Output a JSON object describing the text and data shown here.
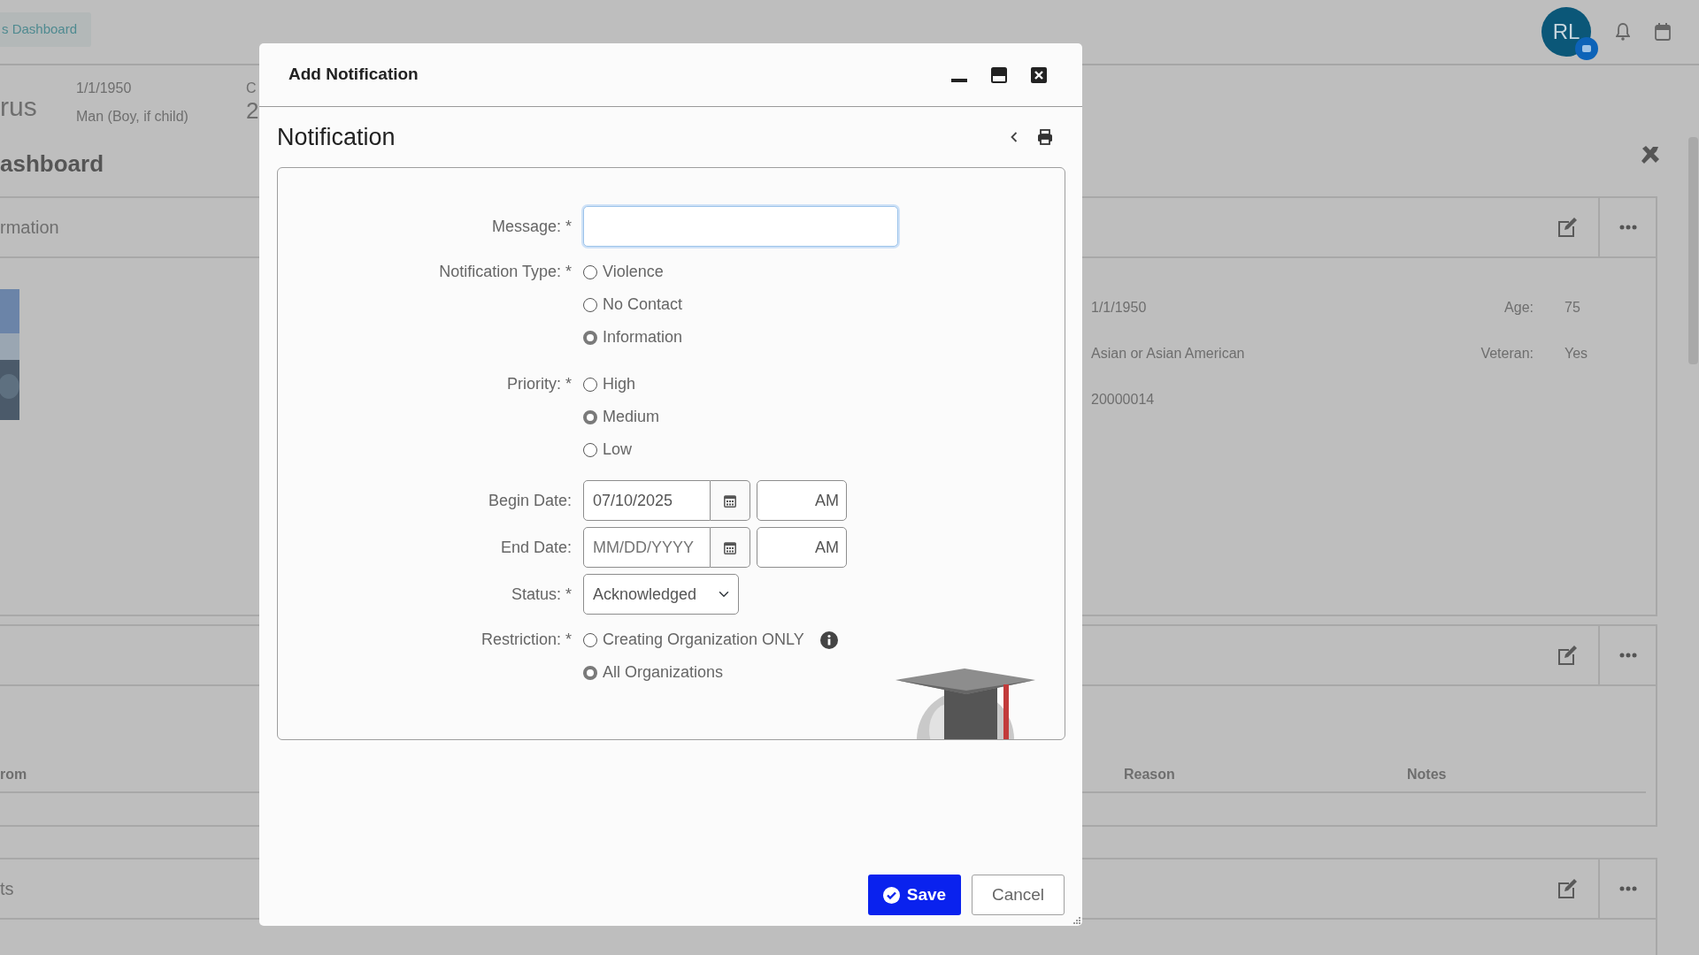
{
  "background": {
    "breadcrumb": "s Dashboard",
    "avatar_initials": "RL",
    "person_name": "rus",
    "birth_date": "1/1/1950",
    "gender": "Man (Boy, if child)",
    "column_3_label": "C",
    "column_3_value": "2",
    "dashboard_title": "ashboard",
    "info_card": {
      "title": "rmation",
      "rows": [
        {
          "value": "1/1/1950",
          "label": "Age:",
          "label_value": "75"
        },
        {
          "value": "Asian or Asian American",
          "label": "Veteran:",
          "label_value": "Yes"
        },
        {
          "value": "20000014"
        }
      ]
    },
    "table_card": {
      "columns": [
        "rom",
        "Reason",
        "Notes"
      ]
    },
    "third_card": {
      "title": "ts"
    }
  },
  "dialog": {
    "title": "Add Notification",
    "heading": "Notification",
    "fields": [
      {
        "kind": "text",
        "label": "Message: *",
        "focused": true
      },
      {
        "kind": "radio",
        "label": "Notification Type: *",
        "options": [
          {
            "label": "Violence",
            "selected": false
          },
          {
            "label": "No Contact",
            "selected": false
          },
          {
            "label": "Information",
            "selected": true
          }
        ]
      },
      {
        "kind": "radio",
        "label": "Priority: *",
        "options": [
          {
            "label": "High",
            "selected": false
          },
          {
            "label": "Medium",
            "selected": true
          },
          {
            "label": "Low",
            "selected": false
          }
        ]
      },
      {
        "kind": "datetime",
        "label": "Begin Date:",
        "value": "07/10/2025",
        "time_value": "AM"
      },
      {
        "kind": "datetime",
        "label": "End Date:",
        "placeholder": "MM/DD/YYYY",
        "time_value": "AM"
      },
      {
        "kind": "select",
        "label": "Status: *",
        "value": "Acknowledged"
      },
      {
        "kind": "radio",
        "label": "Restriction: *",
        "options": [
          {
            "label": "Creating Organization ONLY",
            "selected": false,
            "info": true
          },
          {
            "label": "All Organizations",
            "selected": true
          }
        ]
      }
    ],
    "buttons": [
      {
        "kind": "primary",
        "label": "Save"
      },
      {
        "kind": "secondary",
        "label": "Cancel"
      }
    ]
  }
}
